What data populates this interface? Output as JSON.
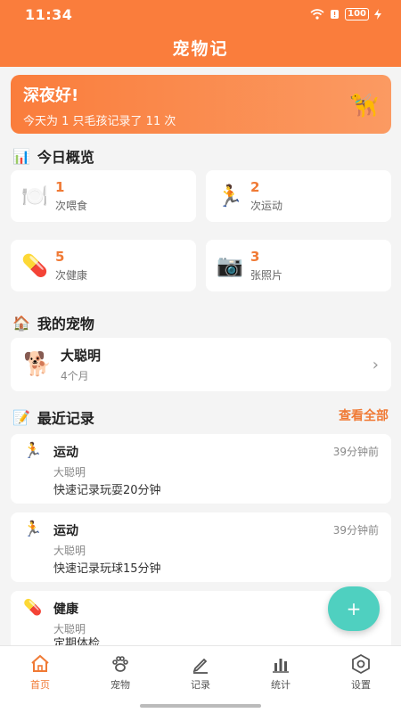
{
  "status_bar": {
    "time": "11:34",
    "battery": "100"
  },
  "app": {
    "title": "宠物记"
  },
  "greeting": {
    "title": "深夜好!",
    "subtitle": "今天为 1 只毛孩记录了 11 次",
    "emoji": "🦮"
  },
  "overview": {
    "title": "今日概览",
    "icon": "📊",
    "stats": [
      {
        "icon": "🍽️",
        "value": "1",
        "label": "次喂食"
      },
      {
        "icon": "🏃",
        "value": "2",
        "label": "次运动"
      },
      {
        "icon": "💊",
        "value": "5",
        "label": "次健康"
      },
      {
        "icon": "📷",
        "value": "3",
        "label": "张照片"
      }
    ]
  },
  "pets": {
    "title": "我的宠物",
    "icon": "🏠",
    "items": [
      {
        "avatar": "🐕",
        "name": "大聪明",
        "age": "4个月"
      }
    ]
  },
  "recent": {
    "title": "最近记录",
    "icon": "📝",
    "see_all": "查看全部",
    "items": [
      {
        "icon": "🏃",
        "type": "运动",
        "time": "39分钟前",
        "pet": "大聪明",
        "note": "快速记录玩耍20分钟"
      },
      {
        "icon": "🏃",
        "type": "运动",
        "time": "39分钟前",
        "pet": "大聪明",
        "note": "快速记录玩球15分钟"
      },
      {
        "icon": "💊",
        "type": "健康",
        "time": "",
        "pet": "大聪明",
        "note": "定期体检"
      }
    ]
  },
  "fab": {
    "label": "+"
  },
  "tabs": [
    {
      "label": "首页",
      "icon": "home-icon",
      "active": true
    },
    {
      "label": "宠物",
      "icon": "paw-icon",
      "active": false
    },
    {
      "label": "记录",
      "icon": "pencil-icon",
      "active": false
    },
    {
      "label": "统计",
      "icon": "bar-chart-icon",
      "active": false
    },
    {
      "label": "设置",
      "icon": "settings-icon",
      "active": false
    }
  ],
  "colors": {
    "brand": "#fa7d3c",
    "accent_text": "#f07a35",
    "fab": "#4fd0c0"
  }
}
